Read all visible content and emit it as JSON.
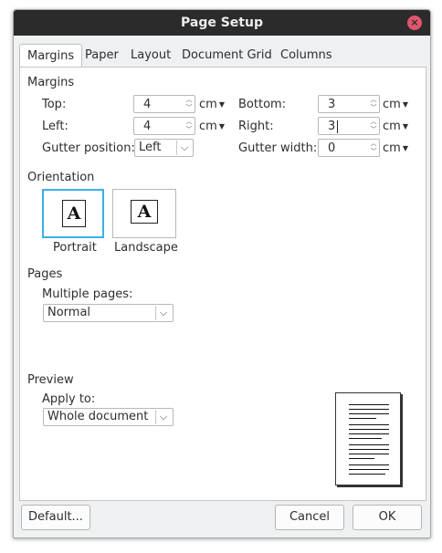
{
  "window": {
    "title": "Page Setup",
    "close_icon": "×"
  },
  "tabs": [
    {
      "label": "Margins",
      "active": true
    },
    {
      "label": "Paper"
    },
    {
      "label": "Layout"
    },
    {
      "label": "Document Grid"
    },
    {
      "label": "Columns"
    }
  ],
  "margins": {
    "heading": "Margins",
    "top": {
      "label": "Top:",
      "value": "4",
      "unit": "cm"
    },
    "left": {
      "label": "Left:",
      "value": "4",
      "unit": "cm"
    },
    "bottom": {
      "label": "Bottom:",
      "value": "3",
      "unit": "cm"
    },
    "right": {
      "label": "Right:",
      "value": "3",
      "unit": "cm"
    },
    "gutter_position": {
      "label": "Gutter position:",
      "value": "Left"
    },
    "gutter_width": {
      "label": "Gutter width:",
      "value": "0",
      "unit": "cm"
    }
  },
  "orientation": {
    "heading": "Orientation",
    "portrait_label": "Portrait",
    "landscape_label": "Landscape",
    "glyph": "A",
    "selected": "portrait"
  },
  "pages": {
    "heading": "Pages",
    "multiple_label": "Multiple pages:",
    "multiple_value": "Normal"
  },
  "preview": {
    "heading": "Preview",
    "apply_label": "Apply to:",
    "apply_value": "Whole document"
  },
  "buttons": {
    "default": "Default...",
    "cancel": "Cancel",
    "ok": "OK"
  },
  "colors": {
    "accent": "#3daee9",
    "titlebar": "#2b2b2b",
    "close": "#e0566c"
  }
}
